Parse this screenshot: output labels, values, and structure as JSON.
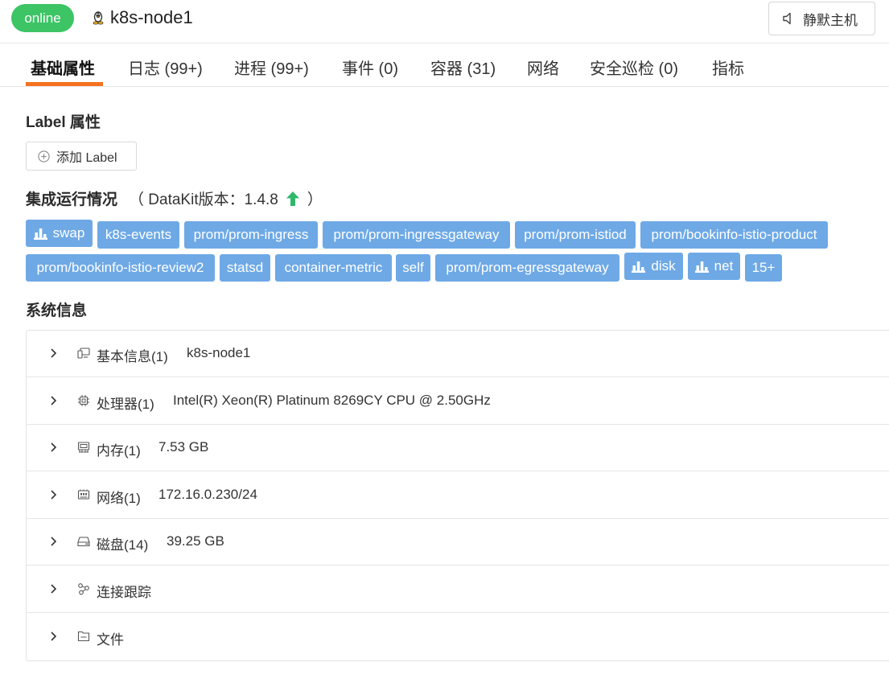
{
  "header": {
    "status": "online",
    "host": "k8s-node1",
    "mute_label": "静默主机",
    "os_icon": "linux-penguin-icon",
    "mute_icon": "speaker-mute-icon",
    "colors": {
      "status": "#3cc465",
      "accent": "#f4721f",
      "tag": "#6ea9e6",
      "upgrade": "#2fb86a"
    }
  },
  "tabs": [
    {
      "label": "基础属性",
      "active": true
    },
    {
      "label": "日志 (99+)"
    },
    {
      "label": "进程 (99+)"
    },
    {
      "label": "事件 (0)"
    },
    {
      "label": "容器 (31)"
    },
    {
      "label": "网络"
    },
    {
      "label": "安全巡检 (0)"
    },
    {
      "label": "指标"
    }
  ],
  "labels": {
    "title": "Label 属性",
    "add_button": "添加 Label"
  },
  "integration": {
    "title": "集成运行情况",
    "version_open": "（ DataKit版本：1.4.8",
    "version_close": "）",
    "tags": [
      {
        "label": "swap",
        "icon": "bar-chart-icon"
      },
      {
        "label": "k8s-events"
      },
      {
        "label": "prom/prom-ingress"
      },
      {
        "label": "prom/prom-ingressgateway"
      },
      {
        "label": "prom/prom-istiod"
      },
      {
        "label": "prom/bookinfo-istio-product"
      },
      {
        "label": "prom/bookinfo-istio-review2"
      },
      {
        "label": "statsd"
      },
      {
        "label": "container-metric"
      },
      {
        "label": "self"
      },
      {
        "label": "prom/prom-egressgateway"
      },
      {
        "label": "disk",
        "icon": "bar-chart-icon"
      },
      {
        "label": "net",
        "icon": "bar-chart-icon"
      },
      {
        "label": "15+"
      }
    ]
  },
  "system": {
    "title": "系统信息",
    "rows": [
      {
        "label": "基本信息(1)",
        "value": "k8s-node1",
        "icon": "host-icon"
      },
      {
        "label": "处理器(1)",
        "value": "Intel(R) Xeon(R) Platinum 8269CY CPU @ 2.50GHz",
        "icon": "cpu-icon"
      },
      {
        "label": "内存(1)",
        "value": "7.53 GB",
        "icon": "memory-icon"
      },
      {
        "label": "网络(1)",
        "value": "172.16.0.230/24",
        "icon": "network-icon"
      },
      {
        "label": "磁盘(14)",
        "value": "39.25 GB",
        "icon": "disk-icon"
      },
      {
        "label": "连接跟踪",
        "value": "",
        "icon": "connection-icon"
      },
      {
        "label": "文件",
        "value": "",
        "icon": "file-icon"
      }
    ]
  }
}
